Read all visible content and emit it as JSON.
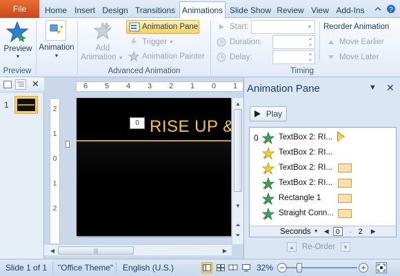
{
  "tabs": {
    "file": "File",
    "items": [
      "Home",
      "Insert",
      "Design",
      "Transitions",
      "Animations",
      "Slide Show",
      "Review",
      "View",
      "Add-Ins"
    ],
    "active": "Animations"
  },
  "ribbon": {
    "preview": {
      "button": "Preview",
      "group": "Preview"
    },
    "animation": {
      "button": "Animation"
    },
    "advanced": {
      "add_animation_line1": "Add",
      "add_animation_line2": "Animation",
      "animation_pane": "Animation Pane",
      "trigger": "Trigger",
      "animation_painter": "Animation Painter",
      "group": "Advanced Animation"
    },
    "timing": {
      "start_label": "Start:",
      "start_value": "",
      "duration_label": "Duration:",
      "duration_value": "",
      "delay_label": "Delay:",
      "delay_value": "",
      "reorder_title": "Reorder Animation",
      "move_earlier": "Move Earlier",
      "move_later": "Move Later",
      "group": "Timing"
    }
  },
  "slides_panel": {
    "slide_number": "1"
  },
  "ruler": {
    "horizontal": [
      "6",
      "5",
      "4",
      "3",
      "2",
      "1",
      "0",
      "1"
    ],
    "vertical": [
      "2",
      "1",
      "0",
      "1",
      "2"
    ]
  },
  "slide": {
    "title": "RISE UP &",
    "animation_tag": "0"
  },
  "animation_pane": {
    "title": "Animation Pane",
    "play": "Play",
    "items": [
      {
        "num": "0",
        "label": "TextBox 2: RI...",
        "star": "green",
        "bar": "triangle"
      },
      {
        "num": "",
        "label": "TextBox 2: RI...",
        "star": "yellow",
        "bar": "none"
      },
      {
        "num": "",
        "label": "TextBox 2: RI...",
        "star": "yellow",
        "bar": "box"
      },
      {
        "num": "",
        "label": "TextBox 2: RI...",
        "star": "green",
        "bar": "box"
      },
      {
        "num": "",
        "label": "Rectangle 1",
        "star": "green",
        "bar": "box"
      },
      {
        "num": "",
        "label": "Straight Conn...",
        "star": "green",
        "bar": "box"
      }
    ],
    "timeline": {
      "unit": "Seconds",
      "start": "0",
      "end": "2"
    },
    "reorder": "Re-Order"
  },
  "statusbar": {
    "slide": "Slide 1 of 1",
    "theme": "\"Office Theme\"",
    "language": "English (U.S.)",
    "zoom": "32%"
  },
  "colors": {
    "file_tab": "#c9461a",
    "accent_gold": "#f6c531",
    "ribbon_text": "#1e395b",
    "highlight": "#f9cf61"
  }
}
